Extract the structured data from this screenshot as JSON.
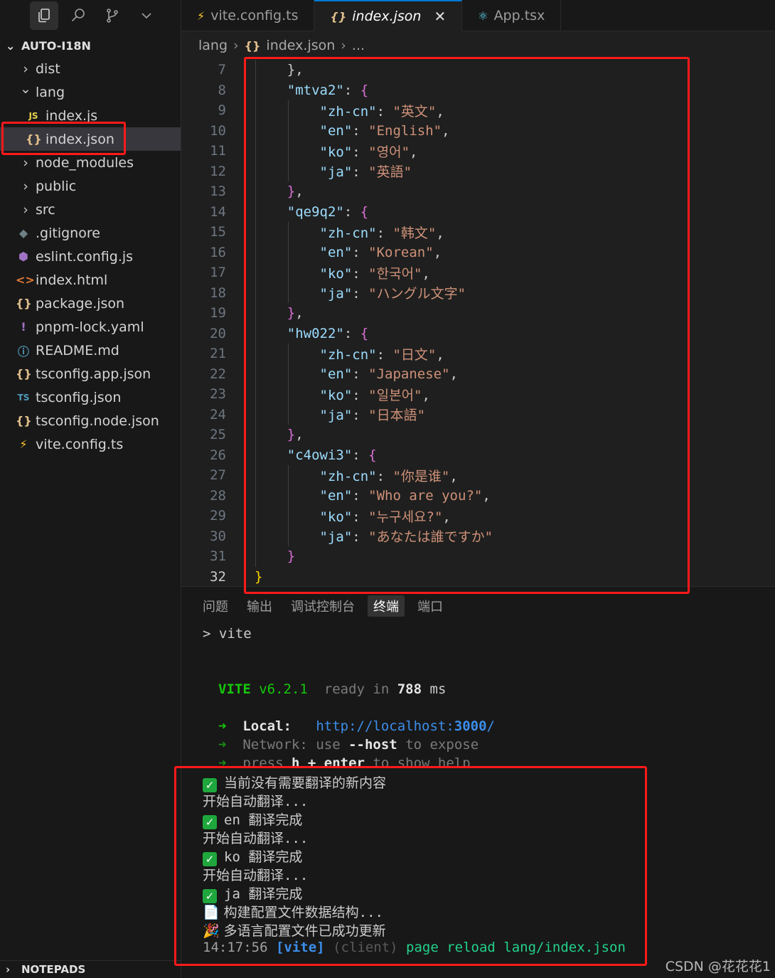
{
  "sidebar": {
    "explorer_title": "AUTO-I18N",
    "notepads_label": "NOTEPADS",
    "items": [
      {
        "label": "dist",
        "kind": "folder",
        "icon": "chevron-right-icon",
        "glyph": "›",
        "icon_color": "#c8c8c8"
      },
      {
        "label": "lang",
        "kind": "folder-open",
        "icon": "chevron-down-icon",
        "glyph": "⌄",
        "icon_color": "#c8c8c8"
      },
      {
        "label": "index.js",
        "kind": "file",
        "icon": "js-file-icon",
        "glyph": "JS",
        "icon_color": "#e8d44d"
      },
      {
        "label": "index.json",
        "kind": "file",
        "icon": "json-file-icon",
        "glyph": "{}",
        "icon_color": "#e2c08d"
      },
      {
        "label": "node_modules",
        "kind": "folder",
        "icon": "chevron-right-icon",
        "glyph": "›",
        "icon_color": "#c8c8c8"
      },
      {
        "label": "public",
        "kind": "folder",
        "icon": "chevron-right-icon",
        "glyph": "›",
        "icon_color": "#c8c8c8"
      },
      {
        "label": "src",
        "kind": "folder",
        "icon": "chevron-right-icon",
        "glyph": "›",
        "icon_color": "#c8c8c8"
      },
      {
        "label": ".gitignore",
        "kind": "file",
        "icon": "git-file-icon",
        "glyph": "◆",
        "icon_color": "#6d8086"
      },
      {
        "label": "eslint.config.js",
        "kind": "file",
        "icon": "eslint-file-icon",
        "glyph": "⬢",
        "icon_color": "#a074c4"
      },
      {
        "label": "index.html",
        "kind": "file",
        "icon": "html-file-icon",
        "glyph": "<>",
        "icon_color": "#e37933"
      },
      {
        "label": "package.json",
        "kind": "file",
        "icon": "json-file-icon",
        "glyph": "{}",
        "icon_color": "#e2c08d"
      },
      {
        "label": "pnpm-lock.yaml",
        "kind": "file",
        "icon": "yaml-file-icon",
        "glyph": "!",
        "icon_color": "#a074c4"
      },
      {
        "label": "README.md",
        "kind": "file",
        "icon": "info-file-icon",
        "glyph": "ⓘ",
        "icon_color": "#519aba"
      },
      {
        "label": "tsconfig.app.json",
        "kind": "file",
        "icon": "json-file-icon",
        "glyph": "{}",
        "icon_color": "#e2c08d"
      },
      {
        "label": "tsconfig.json",
        "kind": "file",
        "icon": "ts-file-icon",
        "glyph": "TS",
        "icon_color": "#519aba"
      },
      {
        "label": "tsconfig.node.json",
        "kind": "file",
        "icon": "json-file-icon",
        "glyph": "{}",
        "icon_color": "#e2c08d"
      },
      {
        "label": "vite.config.ts",
        "kind": "file",
        "icon": "vite-file-icon",
        "glyph": "⚡",
        "icon_color": "#ffcb2b"
      }
    ]
  },
  "tabs": [
    {
      "label": "vite.config.ts",
      "icon": "vite-file-icon",
      "glyph": "⚡",
      "icon_color": "#ffcb2b",
      "active": false
    },
    {
      "label": "index.json",
      "icon": "json-file-icon",
      "glyph": "{}",
      "icon_color": "#e2c08d",
      "active": true,
      "close": "✕"
    },
    {
      "label": "App.tsx",
      "icon": "react-file-icon",
      "glyph": "⚛",
      "icon_color": "#61dafb",
      "active": false
    }
  ],
  "breadcrumb": {
    "segments": [
      "lang",
      "index.json",
      "..."
    ],
    "separator": "›",
    "json_glyph": "{}"
  },
  "editor": {
    "current_line": "32",
    "lines": [
      {
        "n": "7",
        "indent": "    ",
        "parts": [
          [
            "p",
            "},"
          ]
        ]
      },
      {
        "n": "8",
        "indent": "    ",
        "parts": [
          [
            "k",
            "\"mtva2\""
          ],
          [
            "p",
            ": "
          ],
          [
            "b1",
            "{"
          ]
        ]
      },
      {
        "n": "9",
        "indent": "        ",
        "parts": [
          [
            "k",
            "\"zh-cn\""
          ],
          [
            "p",
            ": "
          ],
          [
            "s",
            "\"英文\""
          ],
          [
            "p",
            ","
          ]
        ]
      },
      {
        "n": "10",
        "indent": "        ",
        "parts": [
          [
            "k",
            "\"en\""
          ],
          [
            "p",
            ": "
          ],
          [
            "s",
            "\"English\""
          ],
          [
            "p",
            ","
          ]
        ]
      },
      {
        "n": "11",
        "indent": "        ",
        "parts": [
          [
            "k",
            "\"ko\""
          ],
          [
            "p",
            ": "
          ],
          [
            "s",
            "\"영어\""
          ],
          [
            "p",
            ","
          ]
        ]
      },
      {
        "n": "12",
        "indent": "        ",
        "parts": [
          [
            "k",
            "\"ja\""
          ],
          [
            "p",
            ": "
          ],
          [
            "s",
            "\"英語\""
          ]
        ]
      },
      {
        "n": "13",
        "indent": "    ",
        "parts": [
          [
            "b1",
            "}"
          ],
          [
            "p",
            ","
          ]
        ]
      },
      {
        "n": "14",
        "indent": "    ",
        "parts": [
          [
            "k",
            "\"qe9q2\""
          ],
          [
            "p",
            ": "
          ],
          [
            "b1",
            "{"
          ]
        ]
      },
      {
        "n": "15",
        "indent": "        ",
        "parts": [
          [
            "k",
            "\"zh-cn\""
          ],
          [
            "p",
            ": "
          ],
          [
            "s",
            "\"韩文\""
          ],
          [
            "p",
            ","
          ]
        ]
      },
      {
        "n": "16",
        "indent": "        ",
        "parts": [
          [
            "k",
            "\"en\""
          ],
          [
            "p",
            ": "
          ],
          [
            "s",
            "\"Korean\""
          ],
          [
            "p",
            ","
          ]
        ]
      },
      {
        "n": "17",
        "indent": "        ",
        "parts": [
          [
            "k",
            "\"ko\""
          ],
          [
            "p",
            ": "
          ],
          [
            "s",
            "\"한국어\""
          ],
          [
            "p",
            ","
          ]
        ]
      },
      {
        "n": "18",
        "indent": "        ",
        "parts": [
          [
            "k",
            "\"ja\""
          ],
          [
            "p",
            ": "
          ],
          [
            "s",
            "\"ハングル文字\""
          ]
        ]
      },
      {
        "n": "19",
        "indent": "    ",
        "parts": [
          [
            "b1",
            "}"
          ],
          [
            "p",
            ","
          ]
        ]
      },
      {
        "n": "20",
        "indent": "    ",
        "parts": [
          [
            "k",
            "\"hw022\""
          ],
          [
            "p",
            ": "
          ],
          [
            "b1",
            "{"
          ]
        ]
      },
      {
        "n": "21",
        "indent": "        ",
        "parts": [
          [
            "k",
            "\"zh-cn\""
          ],
          [
            "p",
            ": "
          ],
          [
            "s",
            "\"日文\""
          ],
          [
            "p",
            ","
          ]
        ]
      },
      {
        "n": "22",
        "indent": "        ",
        "parts": [
          [
            "k",
            "\"en\""
          ],
          [
            "p",
            ": "
          ],
          [
            "s",
            "\"Japanese\""
          ],
          [
            "p",
            ","
          ]
        ]
      },
      {
        "n": "23",
        "indent": "        ",
        "parts": [
          [
            "k",
            "\"ko\""
          ],
          [
            "p",
            ": "
          ],
          [
            "s",
            "\"일본어\""
          ],
          [
            "p",
            ","
          ]
        ]
      },
      {
        "n": "24",
        "indent": "        ",
        "parts": [
          [
            "k",
            "\"ja\""
          ],
          [
            "p",
            ": "
          ],
          [
            "s",
            "\"日本語\""
          ]
        ]
      },
      {
        "n": "25",
        "indent": "    ",
        "parts": [
          [
            "b1",
            "}"
          ],
          [
            "p",
            ","
          ]
        ]
      },
      {
        "n": "26",
        "indent": "    ",
        "parts": [
          [
            "k",
            "\"c4owi3\""
          ],
          [
            "p",
            ": "
          ],
          [
            "b1",
            "{"
          ]
        ]
      },
      {
        "n": "27",
        "indent": "        ",
        "parts": [
          [
            "k",
            "\"zh-cn\""
          ],
          [
            "p",
            ": "
          ],
          [
            "s",
            "\"你是谁\""
          ],
          [
            "p",
            ","
          ]
        ]
      },
      {
        "n": "28",
        "indent": "        ",
        "parts": [
          [
            "k",
            "\"en\""
          ],
          [
            "p",
            ": "
          ],
          [
            "s",
            "\"Who are you?\""
          ],
          [
            "p",
            ","
          ]
        ]
      },
      {
        "n": "29",
        "indent": "        ",
        "parts": [
          [
            "k",
            "\"ko\""
          ],
          [
            "p",
            ": "
          ],
          [
            "s",
            "\"누구세요?\""
          ],
          [
            "p",
            ","
          ]
        ]
      },
      {
        "n": "30",
        "indent": "        ",
        "parts": [
          [
            "k",
            "\"ja\""
          ],
          [
            "p",
            ": "
          ],
          [
            "s",
            "\"あなたは誰ですか\""
          ]
        ]
      },
      {
        "n": "31",
        "indent": "    ",
        "parts": [
          [
            "b1",
            "}"
          ]
        ]
      },
      {
        "n": "32",
        "indent": "",
        "parts": [
          [
            "b0",
            "}"
          ]
        ]
      }
    ]
  },
  "panel": {
    "tabs": [
      {
        "label": "问题",
        "active": false
      },
      {
        "label": "输出",
        "active": false
      },
      {
        "label": "调试控制台",
        "active": false
      },
      {
        "label": "终端",
        "active": true
      },
      {
        "label": "端口",
        "active": false
      }
    ],
    "terminal": {
      "prompt": "> vite",
      "vite_name": "VITE",
      "vite_version": "v6.2.1",
      "ready_text": "ready in",
      "ready_ms": "788",
      "ms_unit": "ms",
      "arrow": "➜",
      "local_label": "Local:",
      "local_url_pre": "http://localhost:",
      "local_port": "3000",
      "local_url_post": "/",
      "network_label": "Network:",
      "network_use": "use",
      "network_flag": "--host",
      "network_rest": "to expose",
      "help_press": "press",
      "help_key": "h + enter",
      "help_rest": "to show help",
      "check_glyph": "✓",
      "msg_no_new": "当前没有需要翻译的新内容",
      "msg_start": "开始自动翻译...",
      "msg_en": "en 翻译完成",
      "msg_ko": "ko 翻译完成",
      "msg_ja": "ja 翻译完成",
      "doc_glyph": "📄",
      "msg_build": "构建配置文件数据结构...",
      "party_glyph": "🎉",
      "msg_updated": "多语言配置文件已成功更新",
      "log_time": "14:17:56",
      "log_tag": "[vite]",
      "log_client": "(client)",
      "log_msg": "page reload lang/index.json"
    }
  },
  "watermark": "CSDN @花花花1"
}
